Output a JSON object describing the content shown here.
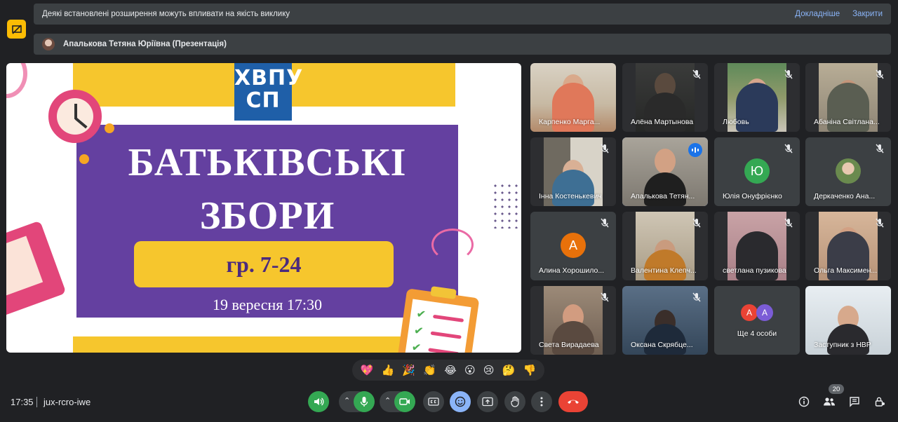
{
  "banner_extensions": {
    "text": "Деякі встановлені розширення можуть впливати на якість виклику",
    "learn_more": "Докладніше",
    "close": "Закрити"
  },
  "banner_presentation": {
    "text": "Апалькова Тетяна Юріївна (Презентація)"
  },
  "slide": {
    "logo_line1": "ХВПУ",
    "logo_line2": "СП",
    "title_line1": "БАТЬКІВСЬКІ",
    "title_line2": "ЗБОРИ",
    "group": "гр. 7-24",
    "datetime": "19 вересня 17:30"
  },
  "participants": [
    {
      "name": "Карпенко Марга..."
    },
    {
      "name": "Алёна Мартынова"
    },
    {
      "name": "Любовь"
    },
    {
      "name": "Абаніна Світлана..."
    },
    {
      "name": "Інна Костенькевич"
    },
    {
      "name": "Апалькова Тетян..."
    },
    {
      "name": "Юлія Онуфрієнко",
      "initial": "Ю"
    },
    {
      "name": "Деркаченко Ана..."
    },
    {
      "name": "Алина Хорошило...",
      "initial": "А"
    },
    {
      "name": "Валентина Клепч..."
    },
    {
      "name": "светлана пузикова"
    },
    {
      "name": "Ольга Максимен..."
    },
    {
      "name": "Света Вирадаева"
    },
    {
      "name": "Оксана Скрябце..."
    },
    {
      "name": "Ще 4 особи",
      "initials": [
        "А",
        "А"
      ]
    },
    {
      "name": "Заступник з НВР"
    }
  ],
  "reactions": [
    "💖",
    "👍",
    "🎉",
    "👏",
    "😂",
    "😮",
    "😢",
    "🤔",
    "👎"
  ],
  "bottom": {
    "time": "17:35",
    "meeting_code": "jux-rcro-iwe",
    "participant_count": "20"
  },
  "colors": {
    "background": "#202124",
    "tile": "#3c4043",
    "accent_blue": "#8ab4f8",
    "mic_green": "#34a853",
    "end_red": "#ea4335",
    "warning_yellow": "#fbbc04",
    "slide_purple": "#6440a0",
    "slide_yellow": "#f6c62d"
  }
}
